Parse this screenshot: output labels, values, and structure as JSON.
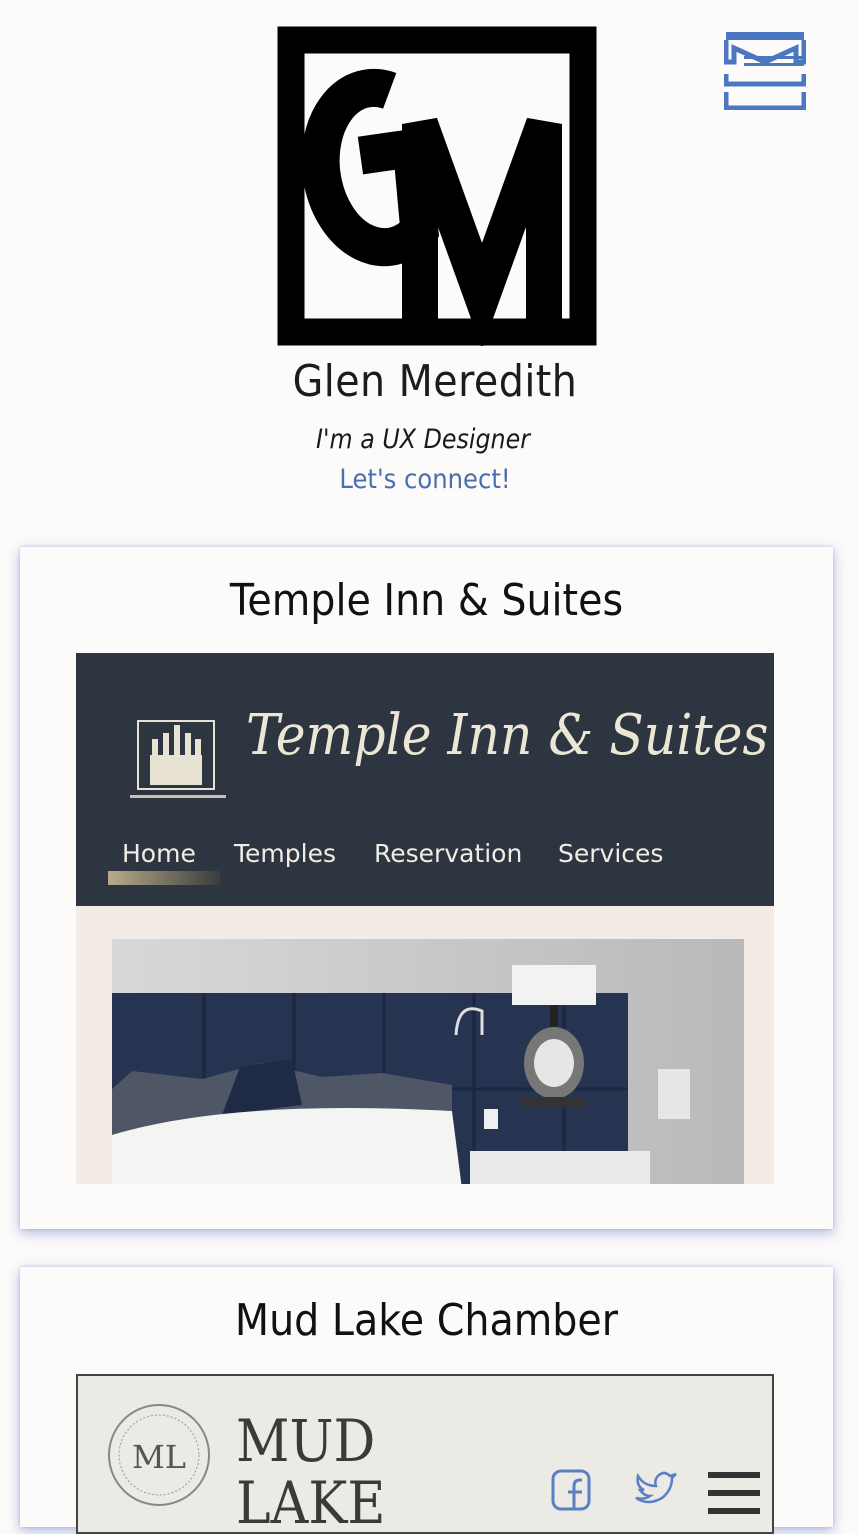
{
  "header": {
    "name": "Glen Meredith",
    "tagline": "I'm a UX Designer",
    "connect_link": "Let's connect!",
    "logo_icon": "gm-monogram-logo",
    "menu_icon": "menu-icon",
    "accent_color": "#4a6fb0"
  },
  "projects": [
    {
      "title": "Temple Inn & Suites",
      "preview": {
        "brand": "Temple Inn & Suites",
        "nav": [
          "Home",
          "Temples",
          "Reservation",
          "Services"
        ]
      }
    },
    {
      "title": "Mud Lake Chamber",
      "preview": {
        "brand_line1": "MUD",
        "brand_line2": "LAKE",
        "seal_text": "ML",
        "icons": [
          "facebook-icon",
          "twitter-icon",
          "hamburger-icon"
        ]
      }
    }
  ]
}
